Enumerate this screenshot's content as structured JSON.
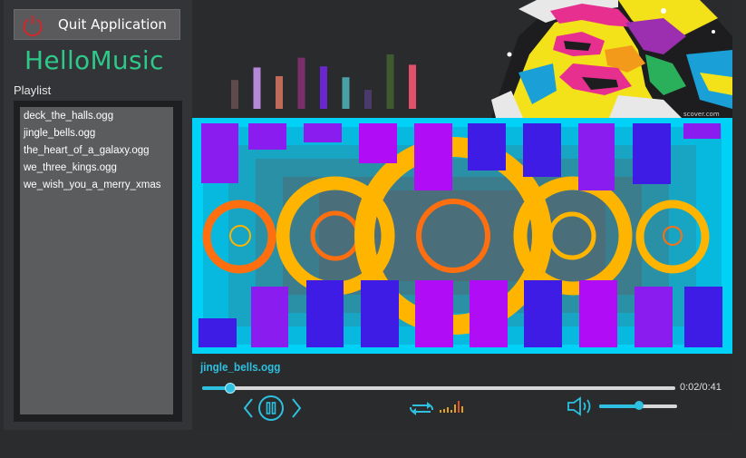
{
  "app": {
    "title": "HelloMusic",
    "quit_label": "Quit Application",
    "playlist_label": "Playlist"
  },
  "playlist": [
    "deck_the_halls.ogg",
    "jingle_bells.ogg",
    "the_heart_of_a_galaxy.ogg",
    "we_three_kings.ogg",
    "we_wish_you_a_merry_xmas"
  ],
  "player": {
    "track_name": "jingle_bells.ogg",
    "time": "0:02/0:41",
    "progress_fraction": 0.06,
    "volume_fraction": 0.51
  },
  "header_art": {
    "watermark": "scover.com",
    "bar_colors": [
      "#5e4a4a",
      "#b488d6",
      "#c06a5a",
      "#7a2f6b",
      "#6b26cf",
      "#4ba0a8",
      "#4a3a6a",
      "#3e5a2e",
      "#e0506a"
    ],
    "bar_levels": [
      0.53,
      0.76,
      0.6,
      0.94,
      0.78,
      0.58,
      0.35,
      1.0,
      0.81
    ]
  },
  "colors": {
    "accent": "#2ec0e0",
    "title_green": "#2ec98a",
    "vis_background": "#00d2f7",
    "ring_orange": "#ffb400",
    "ring_deep_orange": "#ff6f10"
  },
  "icons": {
    "quit": "power-icon",
    "prev": "chevron-left-icon",
    "play_pause": "pause-icon",
    "next": "chevron-right-icon",
    "repeat": "repeat-icon",
    "equalizer": "equalizer-icon",
    "volume": "volume-icon"
  }
}
